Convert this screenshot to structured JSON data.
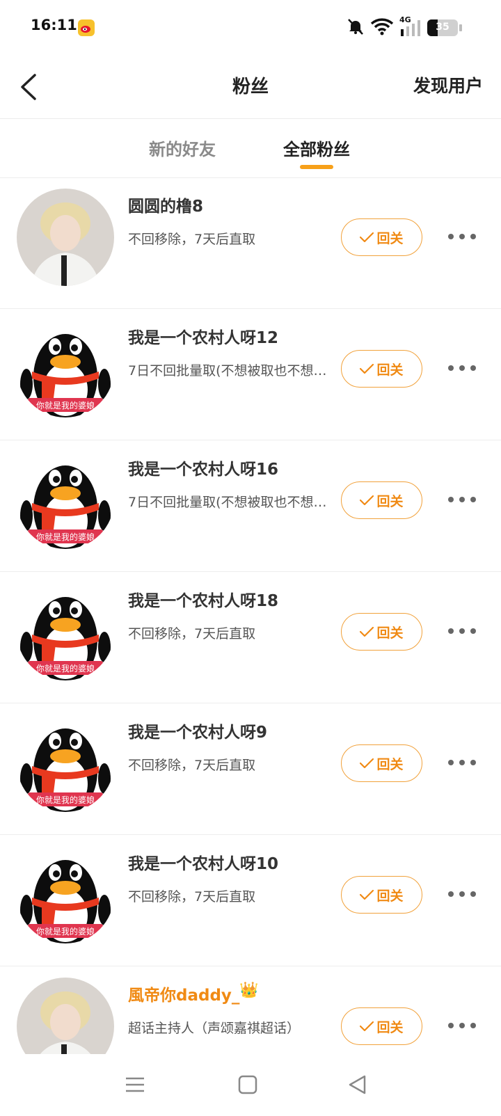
{
  "status_bar": {
    "time": "16:11",
    "battery": "35",
    "network": "4G",
    "battery_level": 0.35
  },
  "header": {
    "title": "粉丝",
    "discover_label": "发现用户"
  },
  "tabs": [
    {
      "label": "新的好友",
      "active": false
    },
    {
      "label": "全部粉丝",
      "active": true
    }
  ],
  "accent_color": "#f08a14",
  "follow_label": "回关",
  "fans": [
    {
      "name": "圆圆的橹8",
      "remark": "不回移除，7天后直取",
      "avatar": "photo-avatar"
    },
    {
      "name": "我是一个农村人呀12",
      "remark": "7日不回批量取(不想被取也不想…",
      "avatar": "penguin-avatar"
    },
    {
      "name": "我是一个农村人呀16",
      "remark": "7日不回批量取(不想被取也不想…",
      "avatar": "penguin-avatar"
    },
    {
      "name": "我是一个农村人呀18",
      "remark": "不回移除，7天后直取",
      "avatar": "penguin-avatar"
    },
    {
      "name": "我是一个农村人呀9",
      "remark": "不回移除，7天后直取",
      "avatar": "penguin-avatar"
    },
    {
      "name": "我是一个农村人呀10",
      "remark": "不回移除，7天后直取",
      "avatar": "penguin-avatar"
    },
    {
      "name": "風帝你daddy_",
      "remark": "超话主持人（声颂嘉祺超话）",
      "avatar": "photo-avatar",
      "vip": true
    }
  ],
  "penguin_caption": "你就是我的婆娘"
}
